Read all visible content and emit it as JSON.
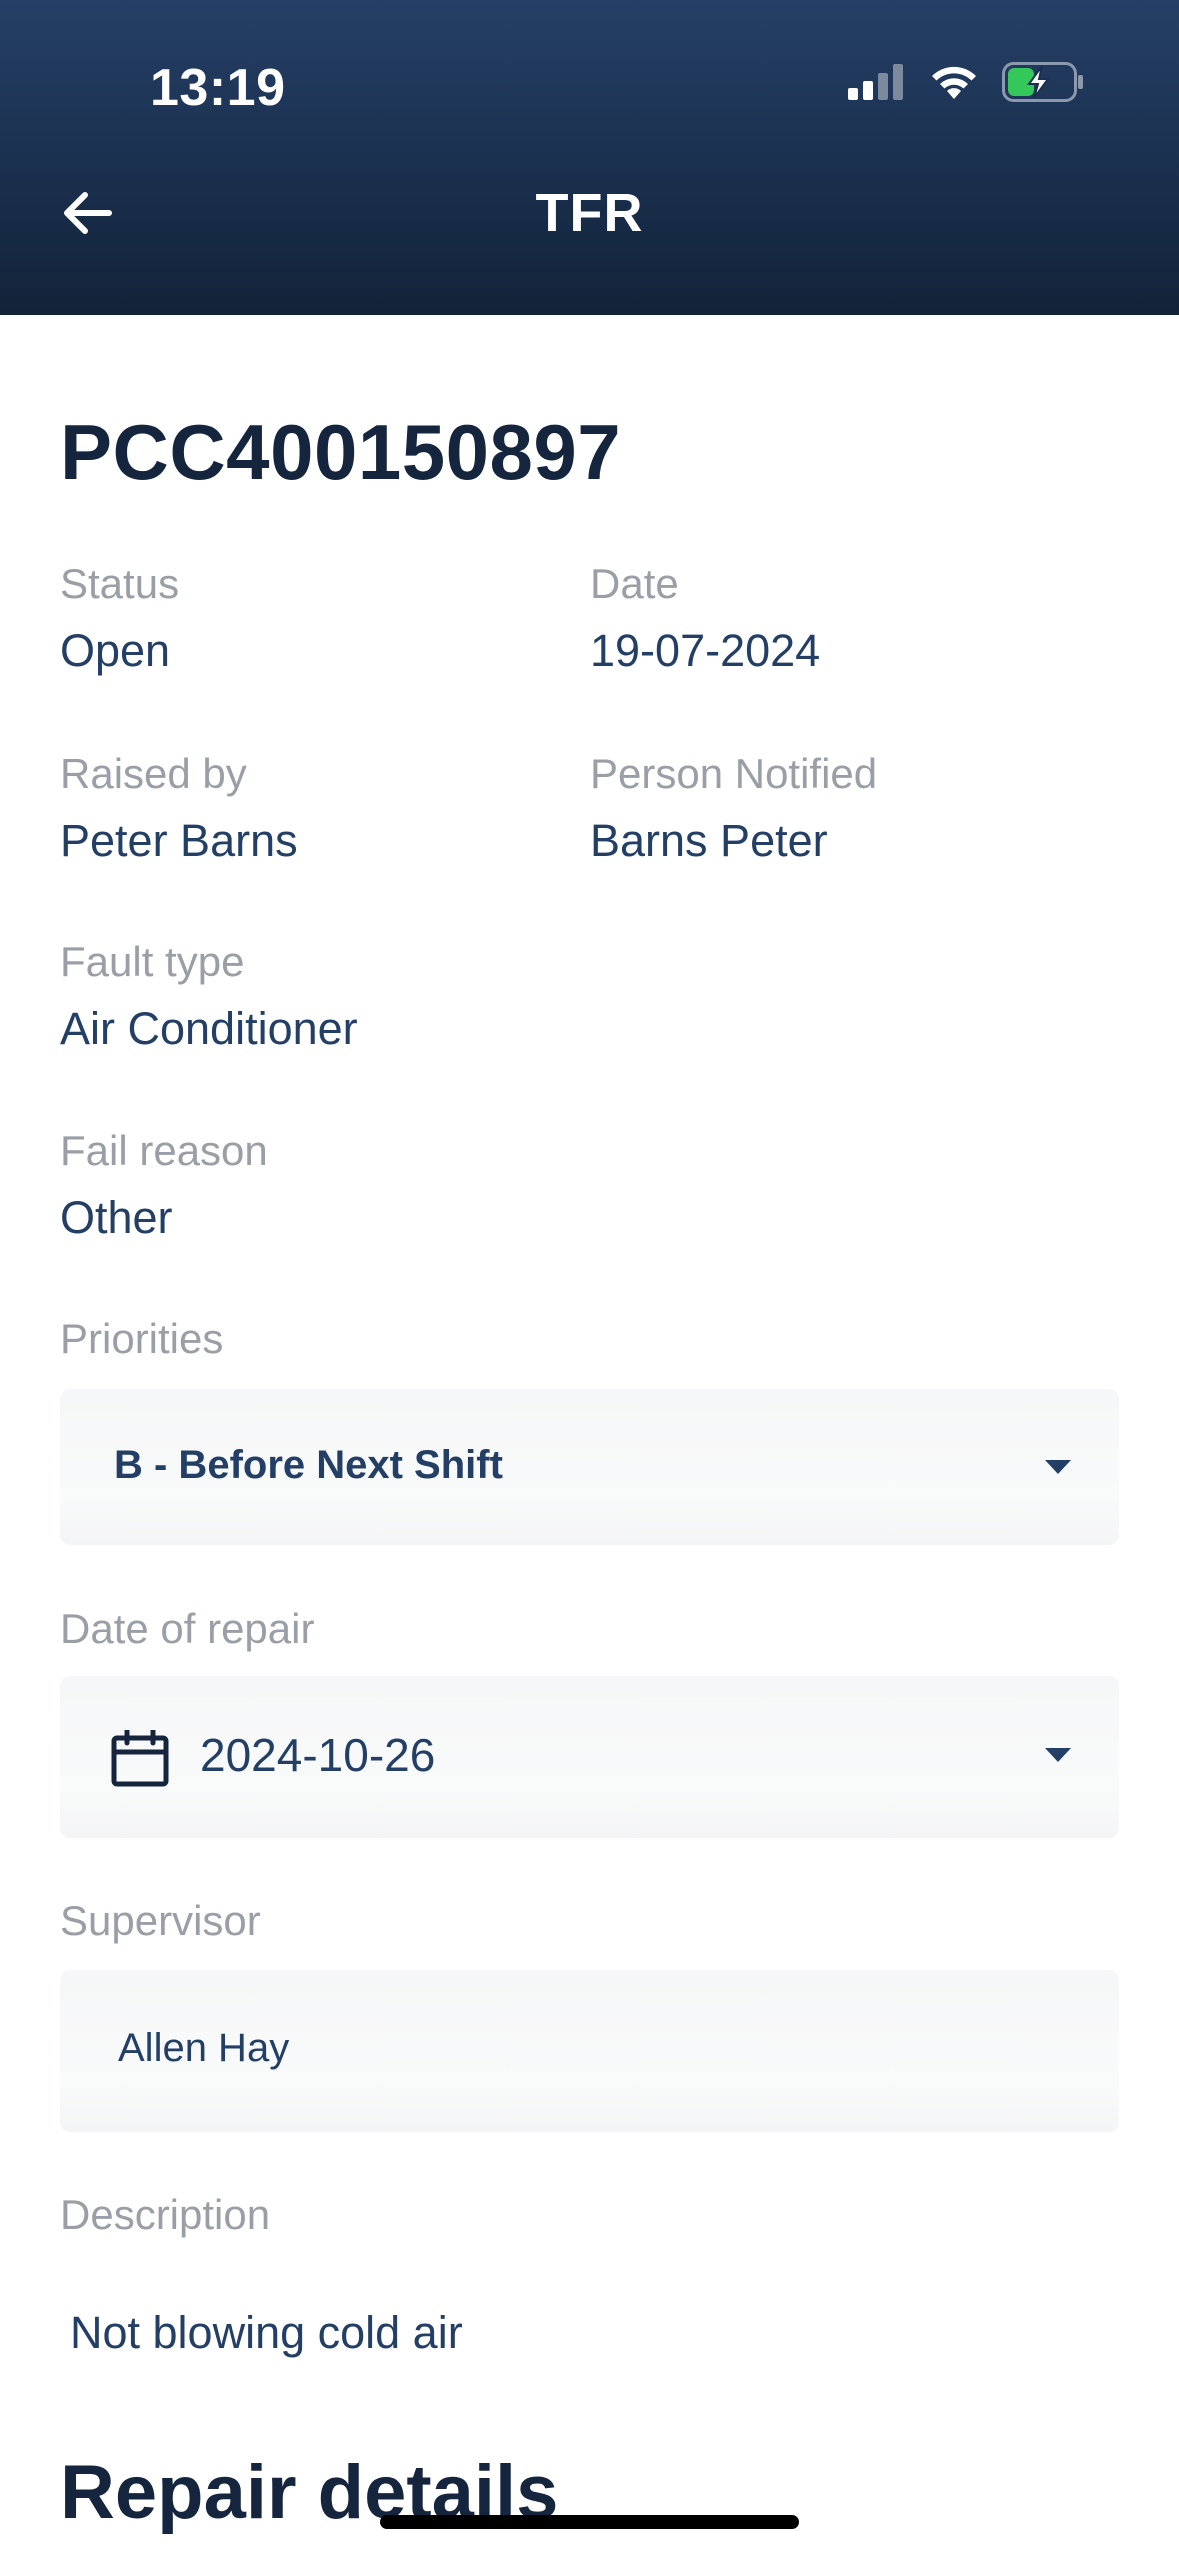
{
  "status_bar": {
    "time": "13:19",
    "icons": [
      "cellular-signal-icon",
      "wifi-icon",
      "battery-charging-icon"
    ]
  },
  "header": {
    "title": "TFR",
    "back_icon": "arrow-left-icon"
  },
  "record": {
    "id": "PCC400150897",
    "status_label": "Status",
    "status_value": "Open",
    "date_label": "Date",
    "date_value": "19-07-2024",
    "raised_by_label": "Raised by",
    "raised_by_value": "Peter Barns",
    "person_notified_label": "Person Notified",
    "person_notified_value": "Barns Peter",
    "fault_type_label": "Fault type",
    "fault_type_value": "Air Conditioner",
    "fail_reason_label": "Fail reason",
    "fail_reason_value": "Other"
  },
  "form": {
    "priorities_label": "Priorities",
    "priorities_value": "B - Before Next Shift",
    "date_of_repair_label": "Date of repair",
    "date_of_repair_value": "2024-10-26",
    "supervisor_label": "Supervisor",
    "supervisor_value": "Allen Hay",
    "description_label": "Description",
    "description_value": "Not blowing cold air"
  },
  "repair": {
    "section_title": "Repair details"
  },
  "colors": {
    "header_bg": "#1b3150",
    "accent_text": "#243f66",
    "label_text": "#9a9ea6",
    "title_text": "#15253d",
    "battery_fill": "#34c759"
  }
}
